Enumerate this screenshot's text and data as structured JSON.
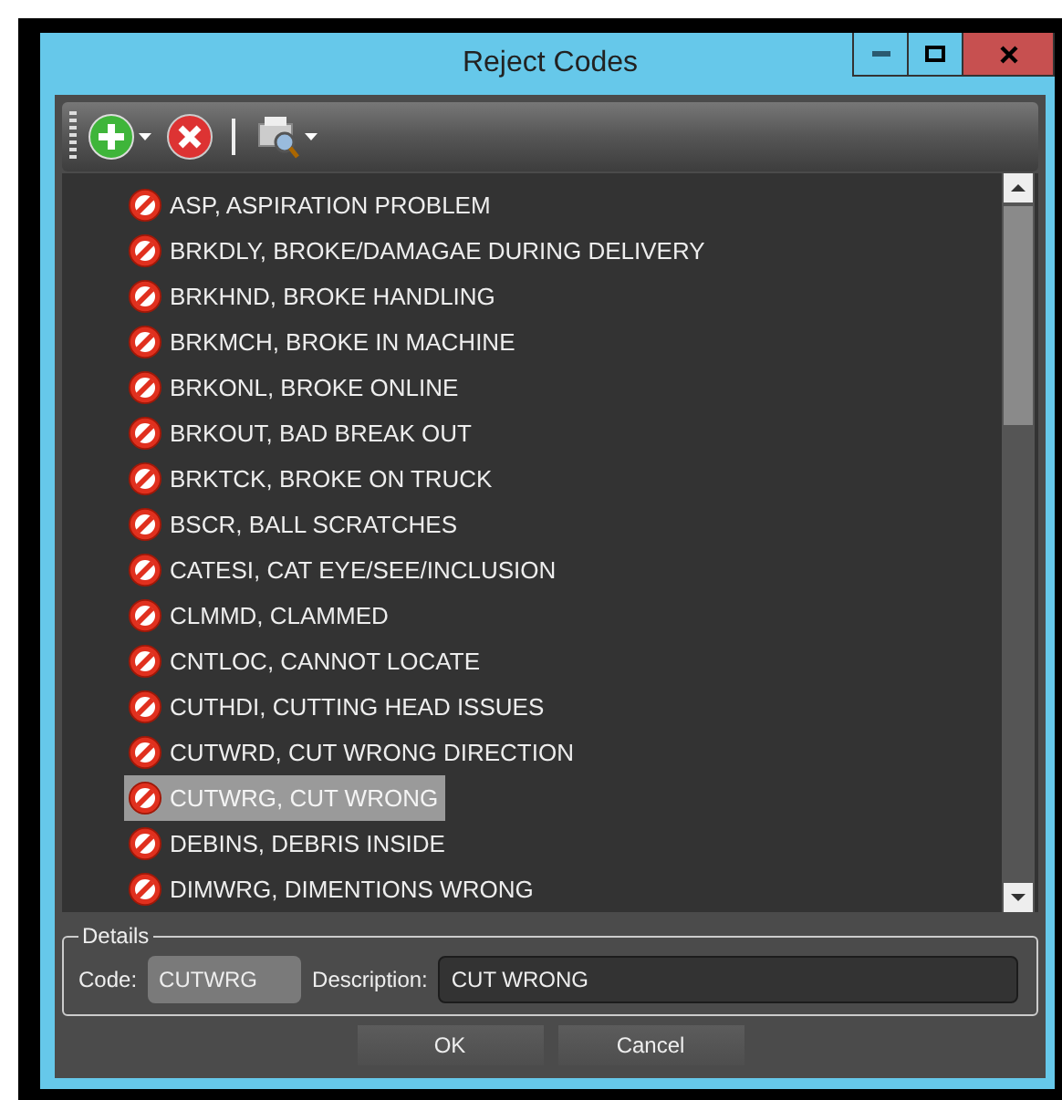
{
  "window": {
    "title": "Reject Codes"
  },
  "codes": [
    {
      "label": "ASP, ASPIRATION PROBLEM",
      "selected": false
    },
    {
      "label": "BRKDLY, BROKE/DAMAGAE DURING DELIVERY",
      "selected": false
    },
    {
      "label": "BRKHND, BROKE HANDLING",
      "selected": false
    },
    {
      "label": "BRKMCH, BROKE IN MACHINE",
      "selected": false
    },
    {
      "label": "BRKONL, BROKE ONLINE",
      "selected": false
    },
    {
      "label": "BRKOUT, BAD BREAK OUT",
      "selected": false
    },
    {
      "label": "BRKTCK, BROKE ON TRUCK",
      "selected": false
    },
    {
      "label": "BSCR, BALL SCRATCHES",
      "selected": false
    },
    {
      "label": "CATESI, CAT EYE/SEE/INCLUSION",
      "selected": false
    },
    {
      "label": "CLMMD, CLAMMED",
      "selected": false
    },
    {
      "label": "CNTLOC, CANNOT LOCATE",
      "selected": false
    },
    {
      "label": "CUTHDI, CUTTING HEAD ISSUES",
      "selected": false
    },
    {
      "label": "CUTWRD, CUT WRONG DIRECTION",
      "selected": false
    },
    {
      "label": "CUTWRG, CUT WRONG",
      "selected": true
    },
    {
      "label": "DEBINS, DEBRIS INSIDE",
      "selected": false
    },
    {
      "label": "DIMWRG, DIMENTIONS WRONG",
      "selected": false
    }
  ],
  "details": {
    "legend": "Details",
    "code_label": "Code:",
    "code_value": "CUTWRG",
    "description_label": "Description:",
    "description_value": "CUT WRONG"
  },
  "buttons": [
    "OK",
    "Cancel"
  ]
}
